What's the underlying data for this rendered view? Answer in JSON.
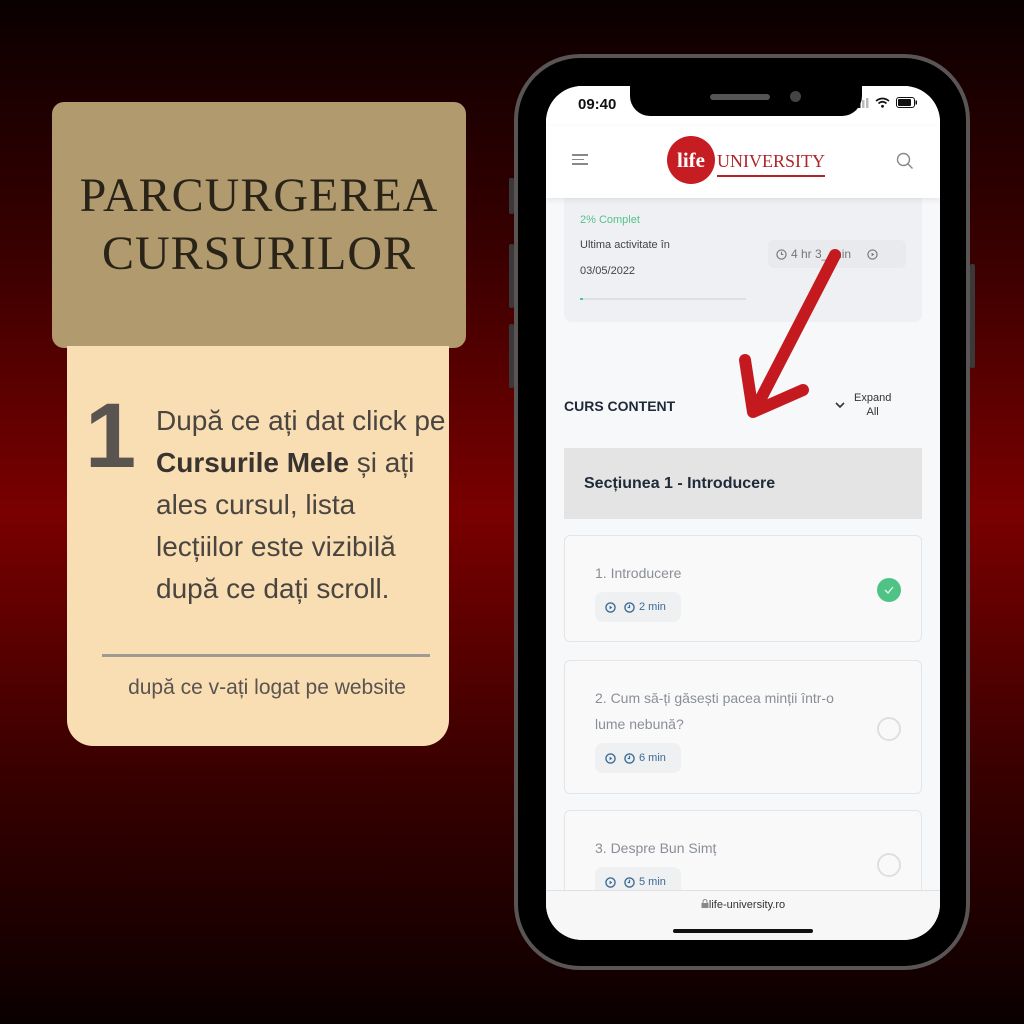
{
  "left_panel": {
    "title_lines": [
      "PARCURGEREA",
      "CURSURILOR"
    ],
    "step_number": "1",
    "step_text_before": "După ce ați dat click pe ",
    "step_text_bold": "Cursurile Mele",
    "step_text_after": " și ați ales cursul, lista lecțiilor este vizibilă după ce dați scroll.",
    "footnote": "după ce v-ați logat pe website"
  },
  "phone": {
    "status_bar": {
      "time": "09:40"
    },
    "header": {
      "logo_circle_text": "life",
      "logo_text": "UNIVERSITY",
      "menu_icon": "hamburger-icon",
      "search_icon": "search-icon"
    },
    "progress": {
      "complete_label": "2% Complet",
      "progress_percent": 2,
      "last_activity_label": "Ultima activitate în",
      "last_activity_date": "03/05/2022",
      "duration": "4 hr 3_ min"
    },
    "course_content": {
      "title": "CURS CONTENT",
      "expand_line1": "Expand",
      "expand_line2": "All",
      "section_title": "Secțiunea 1 - Introducere",
      "lessons": [
        {
          "title": "1. Introducere",
          "duration": "2 min",
          "completed": true
        },
        {
          "title": "2. Cum să-ți găsești pacea minții într-o lume nebună?",
          "duration": "6 min",
          "completed": false
        },
        {
          "title": "3. Despre Bun Simț",
          "duration": "5 min",
          "completed": false
        }
      ]
    },
    "url": "life-university.ro"
  },
  "colors": {
    "accent_red": "#c61d22",
    "complete_green": "#56c28a",
    "title_card": "#b09a6e",
    "info_card": "#f9deb3"
  }
}
